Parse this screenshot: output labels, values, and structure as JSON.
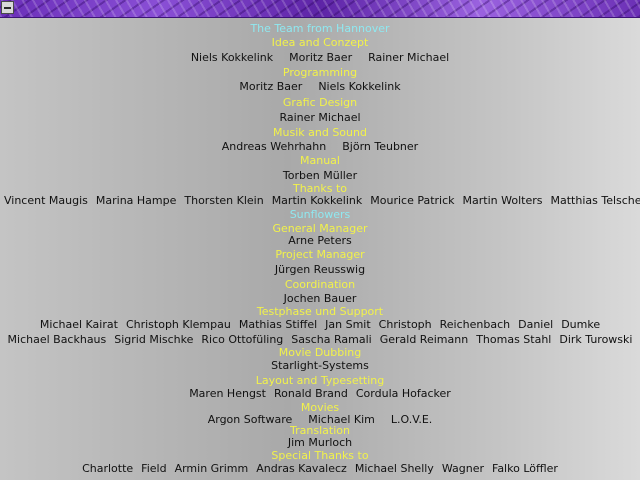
{
  "credits": {
    "team_title": "The  Team from Hannover",
    "idea_title": "Idea and Conzept",
    "idea_names": [
      "Niels Kokkelink",
      "Moritz Baer",
      "Rainer Michael"
    ],
    "programming_title": "Programming",
    "programming_names": [
      "Moritz Baer",
      "Niels Kokkelink"
    ],
    "grafic_title": "Grafic Design",
    "grafic_names": [
      "Rainer Michael"
    ],
    "musik_title": "Musik and Sound",
    "musik_names": [
      "Andreas Wehrhahn",
      "Björn Teubner"
    ],
    "manual_title": "Manual",
    "manual_names": [
      "Torben Müller"
    ],
    "thanks_title": "Thanks to",
    "thanks_names": [
      "Vincent Maugis",
      "Marina Hampe",
      "Thorsten Klein",
      "Martin Kokkelink",
      "Mourice Patrick",
      "Martin Wolters",
      "Matthias Telscher"
    ],
    "sunflowers_title": "Sunflowers",
    "gm_title": "General Manager",
    "gm_names": [
      "Arne Peters"
    ],
    "pm_title": "Project Manager",
    "pm_names": [
      "Jürgen Reusswig"
    ],
    "coord_title": "Coordination",
    "coord_names": [
      "Jochen Bauer"
    ],
    "test_title": "Testphase und Support",
    "test_names_1": [
      "Michael Kairat",
      "Christoph Klempau",
      "Mathias Stiffel",
      "Jan Smit",
      "Christoph",
      "Reichenbach",
      "Daniel",
      "Dumke"
    ],
    "test_names_2": [
      "Michael Backhaus",
      "Sigrid Mischke",
      "Rico Ottofüling",
      "Sascha Ramali",
      "Gerald Reimann",
      "Thomas Stahl",
      "Dirk Turowski"
    ],
    "dubbing_title": "Movie Dubbing",
    "dubbing_names": [
      "Starlight-Systems"
    ],
    "layout_title": "Layout and Typesetting",
    "layout_names": [
      "Maren Hengst",
      "Ronald Brand",
      "Cordula Hofacker"
    ],
    "movies_title": "Movies",
    "movies_names": [
      "Argon Software",
      "Michael Kim",
      "L.O.V.E."
    ],
    "translation_title": "Translation",
    "translation_names": [
      "Jim Murloch"
    ],
    "special_title": "Special Thanks to",
    "special_names": [
      "Charlotte",
      "Field",
      "Armin Grimm",
      "Andras Kavalecz",
      "Michael Shelly",
      "Wagner",
      "Falko Löffler"
    ]
  }
}
